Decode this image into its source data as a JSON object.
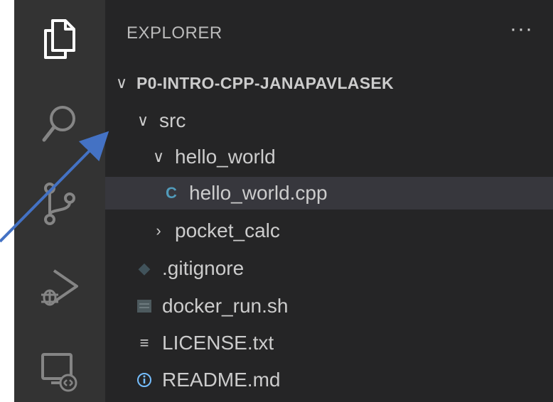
{
  "explorer": {
    "title": "EXPLORER",
    "more_label": "···",
    "project": "P0-INTRO-CPP-JANAPAVLASEK",
    "tree": {
      "src": "src",
      "hello_world_folder": "hello_world",
      "hello_world_file": "hello_world.cpp",
      "pocket_calc": "pocket_calc",
      "gitignore": ".gitignore",
      "docker_run": "docker_run.sh",
      "license": "LICENSE.txt",
      "readme": "README.md"
    }
  },
  "colors": {
    "activity_bar": "#333333",
    "sidebar": "#252526",
    "selected_row": "#37373d",
    "text": "#cccccc",
    "cpp_icon": "#519aba",
    "info_icon": "#75beff",
    "annotation_arrow": "#4472c4"
  },
  "icons": {
    "activity": [
      "explorer-icon",
      "search-icon",
      "source-control-icon",
      "run-debug-icon",
      "remote-explorer-icon"
    ],
    "files": [
      "cpp-file-icon",
      "git-file-icon",
      "shell-file-icon",
      "text-file-icon",
      "info-file-icon"
    ]
  }
}
